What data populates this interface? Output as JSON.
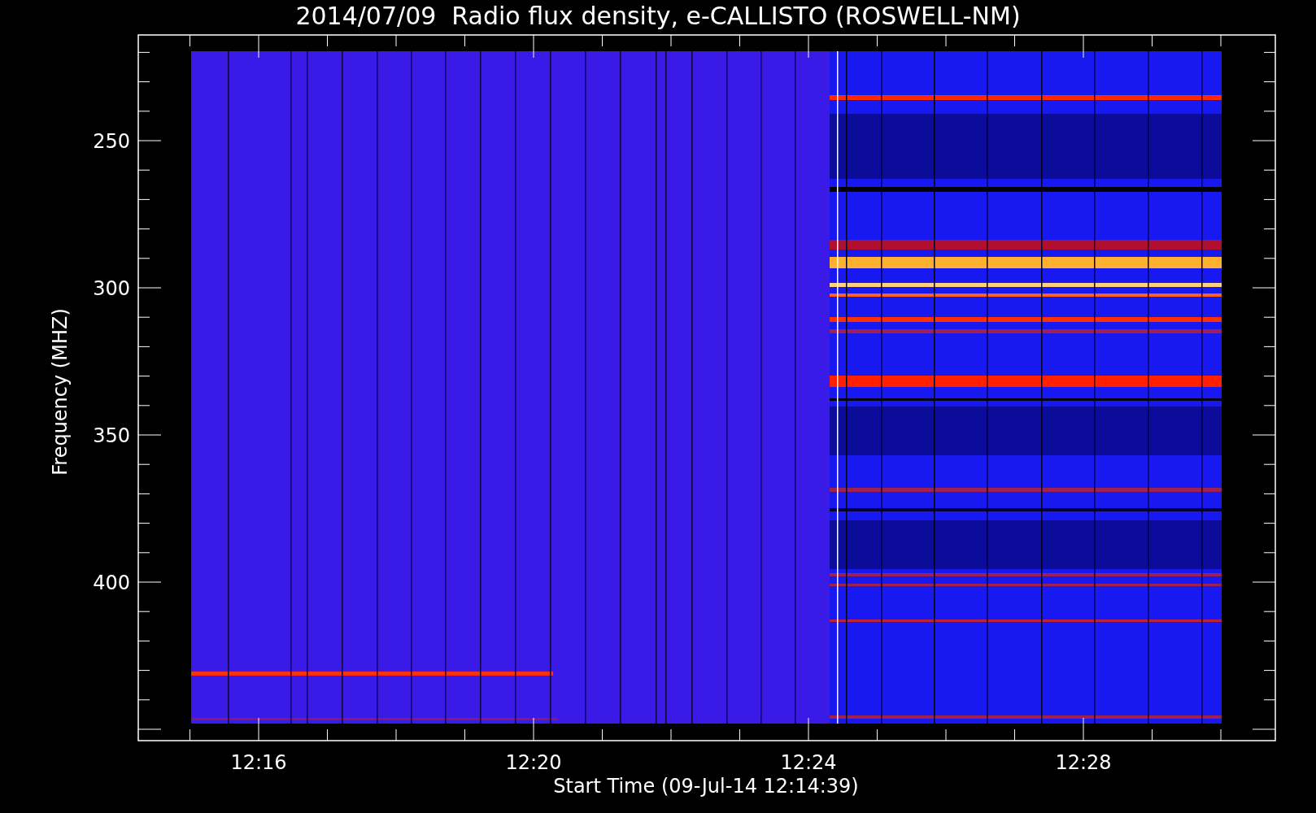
{
  "title": "2014/07/09  Radio flux density, e-CALLISTO (ROSWELL-NM)",
  "y_axis": {
    "label": "Frequency (MHZ)",
    "ticks": [
      "250",
      "300",
      "350",
      "400"
    ]
  },
  "x_axis": {
    "label": "Start Time (09-Jul-14 12:14:39)",
    "ticks": [
      "12:16",
      "12:20",
      "12:24",
      "12:28"
    ]
  }
}
